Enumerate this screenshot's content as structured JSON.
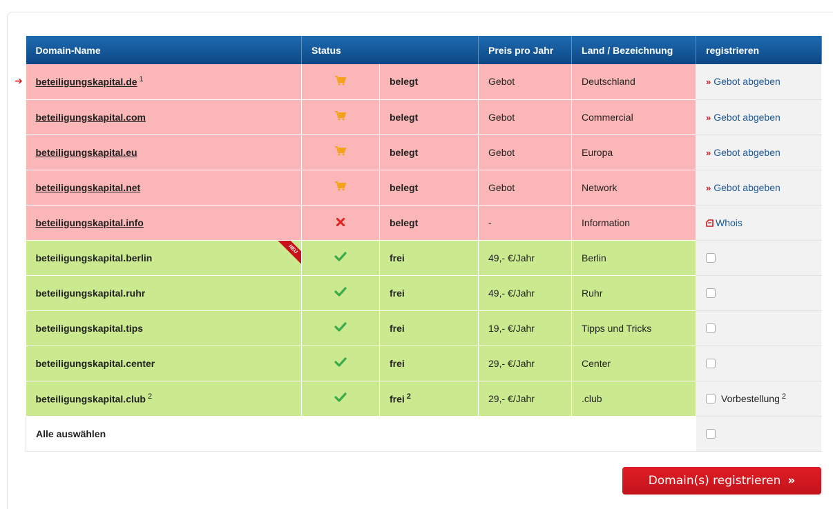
{
  "table": {
    "headers": {
      "domain": "Domain-Name",
      "status": "Status",
      "price": "Preis pro Jahr",
      "country": "Land / Bezeichnung",
      "register": "registrieren"
    },
    "rows": [
      {
        "domain": "beteiligungskapital.de",
        "sup": "1",
        "status": "belegt",
        "price": "Gebot",
        "country": "Deutschland",
        "action": "Gebot abgeben"
      },
      {
        "domain": "beteiligungskapital.com",
        "status": "belegt",
        "price": "Gebot",
        "country": "Commercial",
        "action": "Gebot abgeben"
      },
      {
        "domain": "beteiligungskapital.eu",
        "status": "belegt",
        "price": "Gebot",
        "country": "Europa",
        "action": "Gebot abgeben"
      },
      {
        "domain": "beteiligungskapital.net",
        "status": "belegt",
        "price": "Gebot",
        "country": "Network",
        "action": "Gebot abgeben"
      },
      {
        "domain": "beteiligungskapital.info",
        "status": "belegt",
        "price": "-",
        "country": "Information",
        "action": "Whois"
      },
      {
        "domain": "beteiligungskapital.berlin",
        "badge": "NEU",
        "status": "frei",
        "price": "49,- €/Jahr",
        "country": "Berlin"
      },
      {
        "domain": "beteiligungskapital.ruhr",
        "status": "frei",
        "price": "49,- €/Jahr",
        "country": "Ruhr"
      },
      {
        "domain": "beteiligungskapital.tips",
        "status": "frei",
        "price": "19,- €/Jahr",
        "country": "Tipps und Tricks"
      },
      {
        "domain": "beteiligungskapital.center",
        "status": "frei",
        "price": "29,- €/Jahr",
        "country": "Center"
      },
      {
        "domain": "beteiligungskapital.club",
        "sup": "2",
        "status": "frei",
        "status_sup": "2",
        "price": "29,- €/Jahr",
        "country": ".club",
        "action": "Vorbestellung",
        "action_sup": "2"
      }
    ],
    "select_all": "Alle auswählen"
  },
  "register_button": "Domain(s) registrieren",
  "colors": {
    "header": "#0c4785",
    "taken_row": "#fbb7b7",
    "free_row": "#cbe98f",
    "action_cell": "#f2f2f2",
    "button": "#d01c22",
    "cart_icon": "#f5a21b",
    "check_icon": "#3aaa4a",
    "cross_icon": "#e02424"
  },
  "icons": [
    "arrow-right-icon",
    "shopping-cart-icon",
    "cross-icon",
    "checkmark-icon",
    "double-chevron-icon",
    "whois-icon"
  ]
}
